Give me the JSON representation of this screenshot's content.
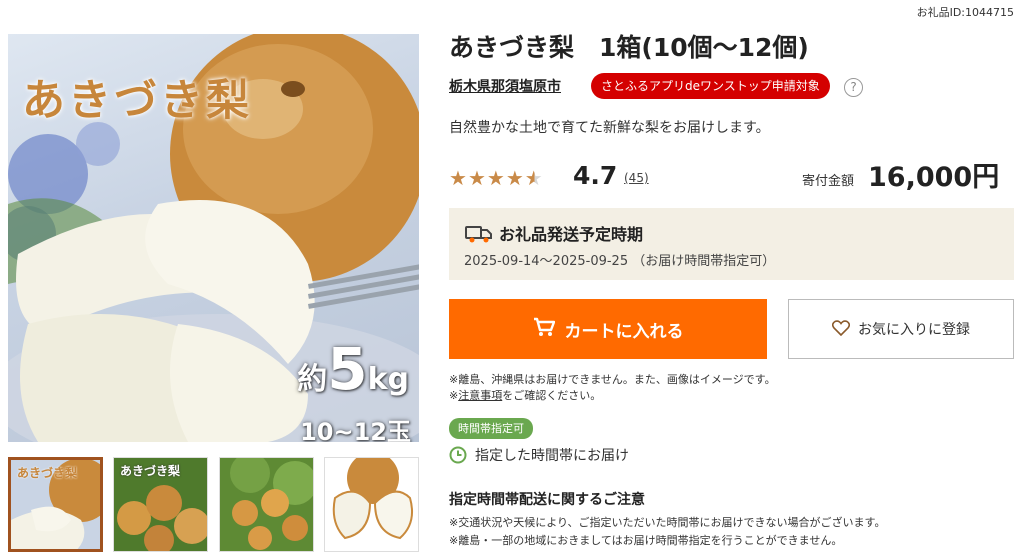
{
  "gift_id": "お礼品ID:1044715",
  "product": {
    "title": "あきづき梨　1箱(10個～12個)",
    "municipality": "栃木県那須塩原市",
    "app_badge": "さとふるアプリdeワンストップ申請対象",
    "help": "?",
    "description": "自然豊かな土地で育てた新鮮な梨をお届けします。"
  },
  "rating": {
    "stars_filled": 4.5,
    "score": "4.7",
    "reviews": "(45)"
  },
  "price": {
    "label": "寄付金額",
    "amount": "16,000円"
  },
  "shipping": {
    "title": "お礼品発送予定時期",
    "dates": "2025-09-14～2025-09-25 （お届け時間帯指定可）"
  },
  "buttons": {
    "cart": "カートに入れる",
    "favorite": "お気に入りに登録"
  },
  "notes": {
    "line1": "※離島、沖縄県はお届けできません。また、画像はイメージです。",
    "line2_prefix": "※",
    "line2_link": "注意事項",
    "line2_suffix": "をご確認ください。"
  },
  "delivery_time": {
    "badge": "時間帯指定可",
    "text": "指定した時間帯にお届け"
  },
  "time_notice": {
    "heading": "指定時間帯配送に関するご注意",
    "line1": "※交通状況や天候により、ご指定いただいた時間帯にお届けできない場合がございます。",
    "line2": "※離島・一部の地域におきましてはお届け時間帯指定を行うことができません。"
  },
  "main_image": {
    "title": "あきづき梨",
    "weight_prefix": "約",
    "weight_num": "5",
    "weight_unit": "kg",
    "count": "10~12玉"
  },
  "thumbnails": [
    {
      "label": "あきづき梨",
      "active": true
    },
    {
      "label": "あきづき梨",
      "active": false
    },
    {
      "label": "",
      "active": false
    },
    {
      "label": "",
      "active": false
    }
  ],
  "colors": {
    "cart": "#ff6a00",
    "app_badge": "#d40000",
    "star": "#c98a48",
    "ship_bg": "#f3efe4",
    "time_badge": "#6aa84f"
  },
  "icons": [
    "cart-icon",
    "heart-icon",
    "truck-icon",
    "clock-icon",
    "question-icon",
    "star-icon"
  ]
}
